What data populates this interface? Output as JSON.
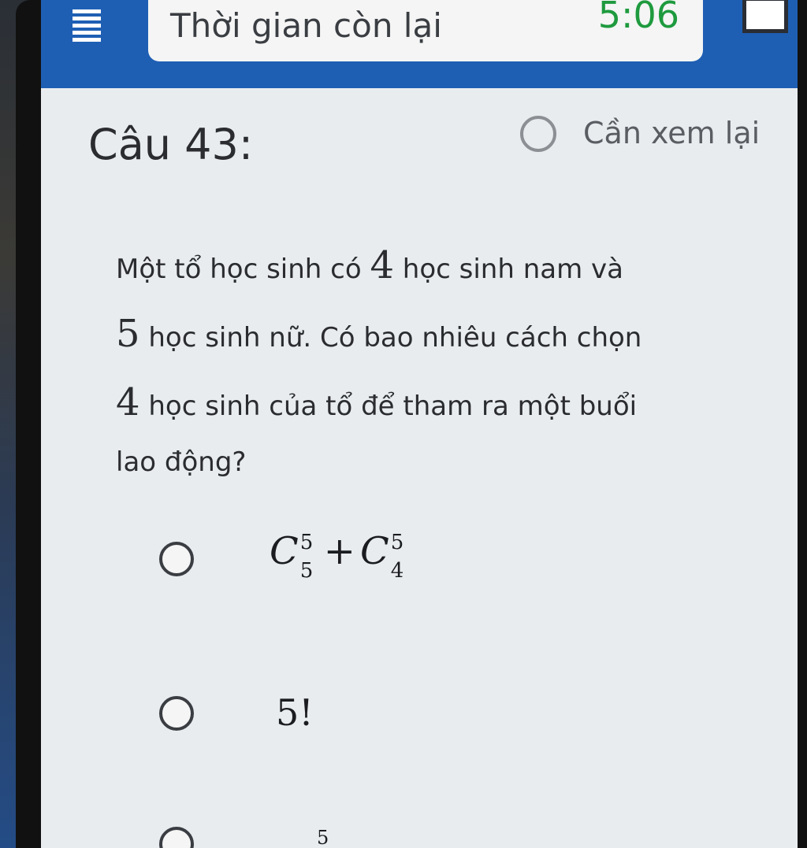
{
  "header": {
    "timer_label": "Thời gian còn lại",
    "timer_value": "5:06",
    "icons": [
      "menu-icon",
      "square-icon"
    ]
  },
  "question": {
    "title": "Câu 43:",
    "review_label": "Cần xem lại",
    "text_part1": "Một tổ học sinh có ",
    "num1": "4",
    "text_part2": " học sinh nam và",
    "num2": "5",
    "text_part3": " học sinh nữ. Có bao nhiêu cách chọn",
    "num3": "4",
    "text_part4": " học sinh của tổ để tham ra một buổi",
    "text_part5": "lao động?"
  },
  "options": {
    "opt1": {
      "c1": "C",
      "c1_sup": "5",
      "c1_sub": "5",
      "plus": "+",
      "c2": "C",
      "c2_sup": "5",
      "c2_sub": "4"
    },
    "opt2": {
      "text": "5!"
    },
    "opt3": {
      "text": "5"
    }
  },
  "colors": {
    "topbar": "#1e5fb4",
    "timer": "#1e9a3e"
  }
}
